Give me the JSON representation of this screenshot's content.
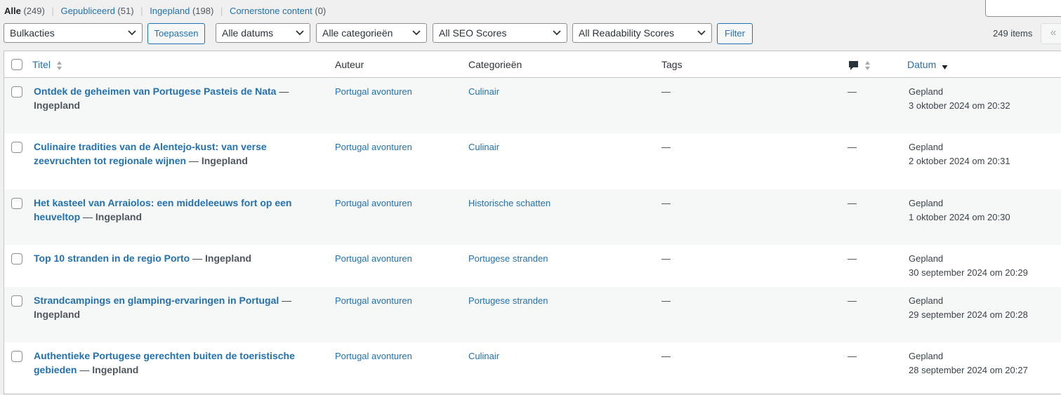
{
  "views": [
    {
      "label": "Alle",
      "count": "(249)",
      "current": true
    },
    {
      "label": "Gepubliceerd",
      "count": "(51)",
      "current": false
    },
    {
      "label": "Ingepland",
      "count": "(198)",
      "current": false
    },
    {
      "label": "Cornerstone content",
      "count": "(0)",
      "current": false
    }
  ],
  "toolbar": {
    "bulk_actions": "Bulkacties",
    "apply_label": "Toepassen",
    "dates_filter": "Alle datums",
    "categories_filter": "Alle categorieën",
    "seo_filter": "All SEO Scores",
    "readability_filter": "All Readability Scores",
    "filter_label": "Filter",
    "items_count": "249 items",
    "first_page": "«"
  },
  "columns": {
    "title": "Titel",
    "author": "Auteur",
    "categories": "Categorieën",
    "tags": "Tags",
    "date": "Datum"
  },
  "colors": {
    "link": "#2271b1",
    "alt_row": "#f6f7f7",
    "background": "#f0f0f1"
  },
  "rows": [
    {
      "title": "Ontdek de geheimen van Portugese Pasteis de Nata",
      "state": "Ingepland",
      "author": "Portugal avonturen",
      "category": "Culinair",
      "tags": "—",
      "comments": "—",
      "date_status": "Gepland",
      "date": "3 oktober 2024 om 20:32"
    },
    {
      "title": "Culinaire tradities van de Alentejo-kust: van verse zeevruchten tot regionale wijnen",
      "state": "Ingepland",
      "author": "Portugal avonturen",
      "category": "Culinair",
      "tags": "—",
      "comments": "—",
      "date_status": "Gepland",
      "date": "2 oktober 2024 om 20:31"
    },
    {
      "title": "Het kasteel van Arraiolos: een middeleeuws fort op een heuveltop",
      "state": "Ingepland",
      "author": "Portugal avonturen",
      "category": "Historische schatten",
      "tags": "—",
      "comments": "—",
      "date_status": "Gepland",
      "date": "1 oktober 2024 om 20:30"
    },
    {
      "title": "Top 10 stranden in de regio Porto",
      "state": "Ingepland",
      "author": "Portugal avonturen",
      "category": "Portugese stranden",
      "tags": "—",
      "comments": "—",
      "date_status": "Gepland",
      "date": "30 september 2024 om 20:29"
    },
    {
      "title": "Strandcampings en glamping-ervaringen in Portugal",
      "state": "Ingepland",
      "author": "Portugal avonturen",
      "category": "Portugese stranden",
      "tags": "—",
      "comments": "—",
      "date_status": "Gepland",
      "date": "29 september 2024 om 20:28"
    },
    {
      "title": "Authentieke Portugese gerechten buiten de toeristische gebieden",
      "state": "Ingepland",
      "author": "Portugal avonturen",
      "category": "Culinair",
      "tags": "—",
      "comments": "—",
      "date_status": "Gepland",
      "date": "28 september 2024 om 20:27"
    }
  ]
}
